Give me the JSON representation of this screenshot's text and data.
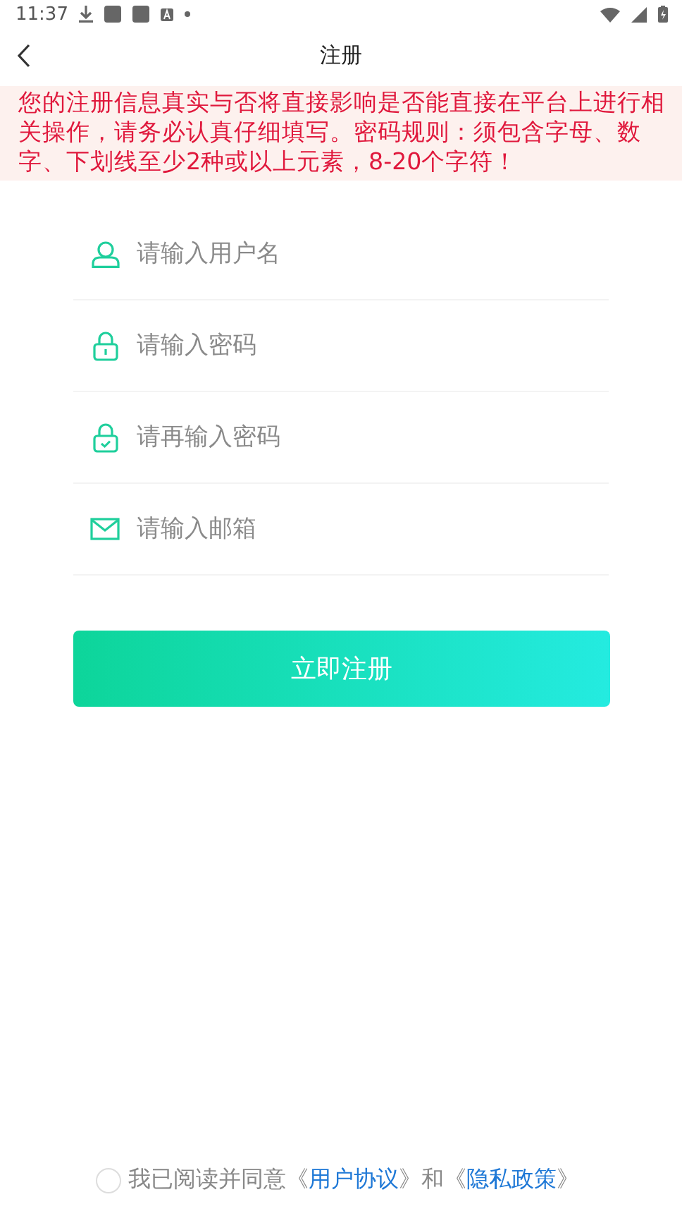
{
  "status_bar": {
    "time": "11:37"
  },
  "nav": {
    "title": "注册"
  },
  "notice": "您的注册信息真实与否将直接影响是否能直接在平台上进行相关操作，请务必认真仔细填写。密码规则：须包含字母、数字、下划线至少2种或以上元素，8-20个字符！",
  "fields": [
    {
      "kind": "user",
      "placeholder": "请输入用户名"
    },
    {
      "kind": "lock",
      "placeholder": "请输入密码"
    },
    {
      "kind": "lock-check",
      "placeholder": "请再输入密码"
    },
    {
      "kind": "mail",
      "placeholder": "请输入邮箱"
    }
  ],
  "submit": "立即注册",
  "agreement": {
    "checked": false,
    "parts": [
      {
        "kind": "text",
        "text": "我已阅读并同意《"
      },
      {
        "kind": "link",
        "text": "用户协议"
      },
      {
        "kind": "text",
        "text": "》和《"
      },
      {
        "kind": "link",
        "text": "隐私政策"
      },
      {
        "kind": "text",
        "text": "》"
      }
    ]
  }
}
